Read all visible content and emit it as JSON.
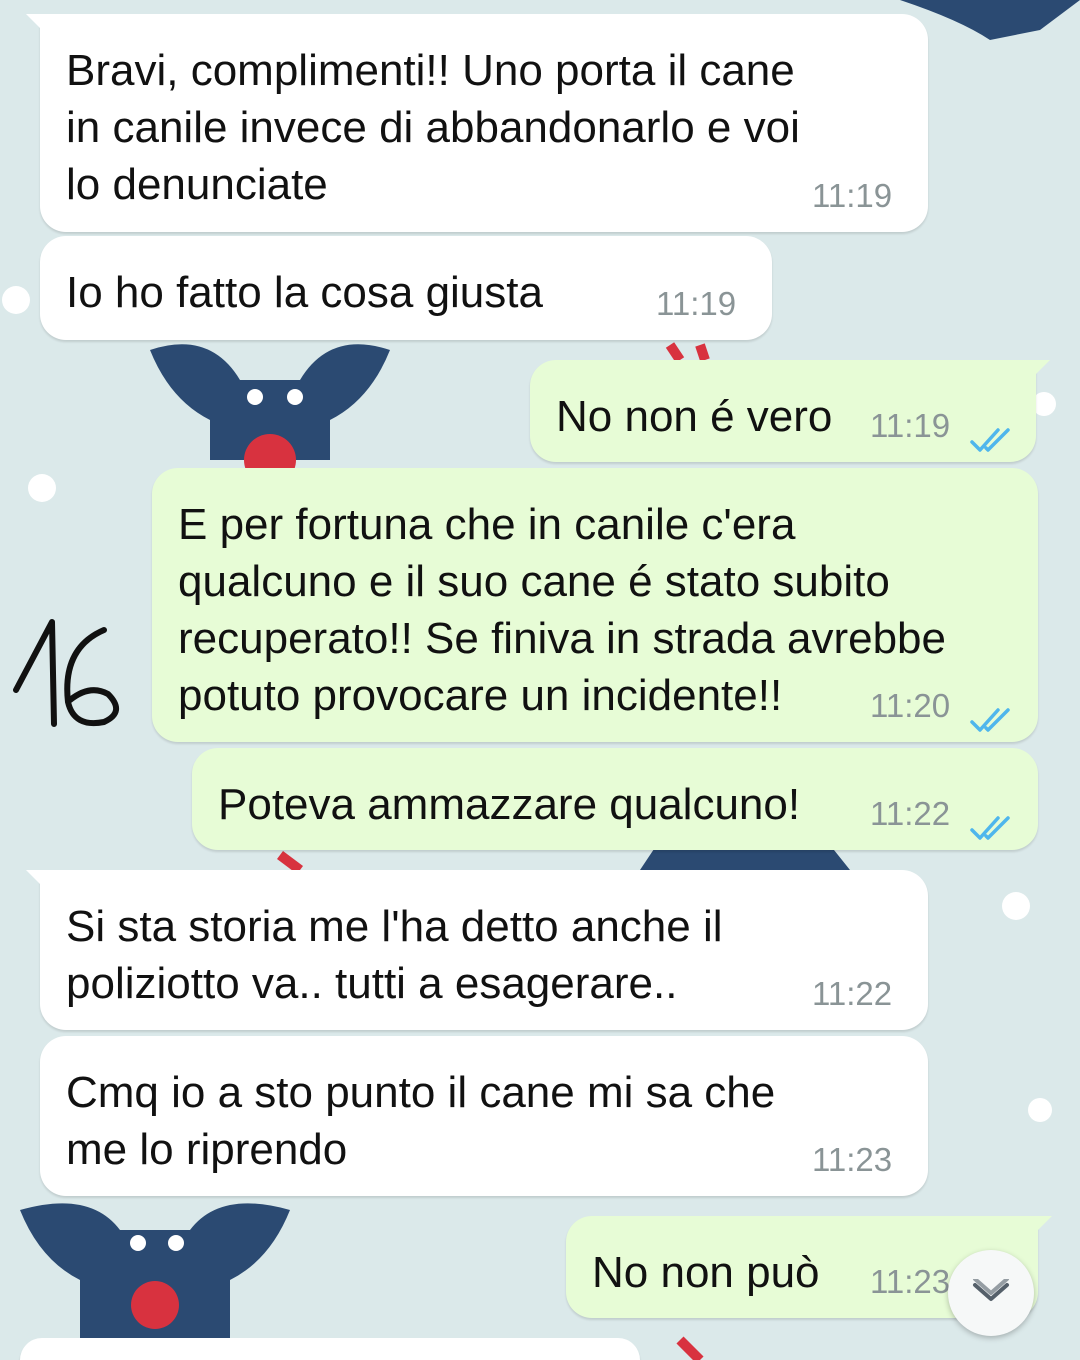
{
  "colors": {
    "wallpaper": "#dbe9ea",
    "incoming_bubble": "#ffffff",
    "outgoing_bubble": "#e7fcd6",
    "read_ticks": "#4fb6ec",
    "timestamp": "#8a9496"
  },
  "annotation": {
    "handwritten": "16"
  },
  "messages": [
    {
      "direction": "incoming",
      "text": "Bravi, complimenti!! Uno porta il cane\nin canile invece di abbandonarlo e voi\nlo denunciate",
      "time": "11:19"
    },
    {
      "direction": "incoming",
      "text": "Io ho fatto la cosa giusta",
      "time": "11:19"
    },
    {
      "direction": "outgoing",
      "text": "No non é vero",
      "time": "11:19",
      "status": "read"
    },
    {
      "direction": "outgoing",
      "text": "E per fortuna che in canile c'era\nqualcuno e il suo cane é stato subito\nrecuperato!! Se finiva in strada avrebbe\npotuto provocare un incidente!!",
      "time": "11:20",
      "status": "read"
    },
    {
      "direction": "outgoing",
      "text": "Poteva ammazzare qualcuno!",
      "time": "11:22",
      "status": "read"
    },
    {
      "direction": "incoming",
      "text": "Si sta storia me l'ha detto anche il\npoliziotto va.. tutti a esagerare..",
      "time": "11:22"
    },
    {
      "direction": "incoming",
      "text": "Cmq io a sto punto il cane mi sa che\nme lo riprendo",
      "time": "11:23"
    },
    {
      "direction": "outgoing",
      "text": "No non può",
      "time": "11:23",
      "status": "read"
    }
  ],
  "scroll_button": {
    "icon": "chevron-down-icon"
  }
}
